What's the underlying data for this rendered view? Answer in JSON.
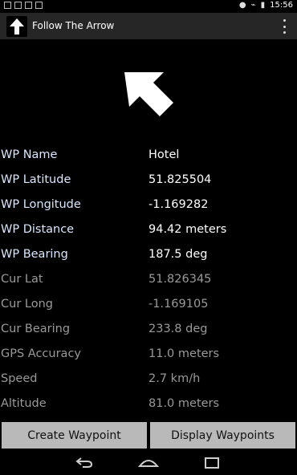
{
  "status_bar": {
    "time": "15:56"
  },
  "app_bar": {
    "title": "Follow The Arrow"
  },
  "waypoint": [
    {
      "label": "WP Name",
      "value": "Hotel"
    },
    {
      "label": "WP Latitude",
      "value": "51.825504"
    },
    {
      "label": "WP Longitude",
      "value": "-1.169282"
    },
    {
      "label": "WP Distance",
      "value": "94.42 meters"
    },
    {
      "label": "WP Bearing",
      "value": "187.5 deg"
    }
  ],
  "current": [
    {
      "label": "Cur Lat",
      "value": "51.826345"
    },
    {
      "label": "Cur Long",
      "value": "-1.169105"
    },
    {
      "label": "Cur Bearing",
      "value": "233.8 deg"
    },
    {
      "label": "GPS Accuracy",
      "value": "11.0 meters"
    },
    {
      "label": "Speed",
      "value": "2.7 km/h"
    },
    {
      "label": "Altitude",
      "value": "81.0 meters"
    }
  ],
  "buttons": {
    "create": "Create Waypoint",
    "display": "Display Waypoints"
  },
  "icons": {
    "app": "up-arrow-icon",
    "direction": "direction-arrow-icon",
    "overflow": "overflow-menu-icon",
    "nav": [
      "back-icon",
      "home-icon",
      "recent-apps-icon"
    ]
  },
  "colors": {
    "action_bar": "#262626",
    "button": "#b9b9b9",
    "wp_label": "#dbe7ff",
    "cur_text": "#9a9a9a"
  }
}
